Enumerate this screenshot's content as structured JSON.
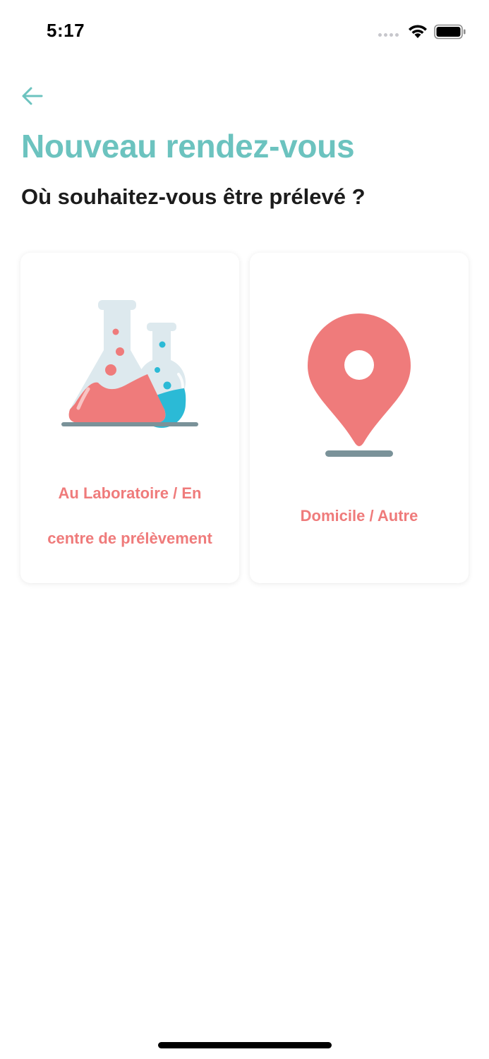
{
  "status_bar": {
    "time": "5:17",
    "icons": [
      "signal-icon",
      "wifi-icon",
      "battery-icon"
    ]
  },
  "header": {
    "back_icon": "arrow-left-icon",
    "title": "Nouveau rendez-vous",
    "subtitle": "Où souhaitez-vous être prélevé ?"
  },
  "options": [
    {
      "icon": "lab-flasks-icon",
      "label_line1": "Au Laboratoire / En",
      "label_line2": "centre de prélèvement"
    },
    {
      "icon": "location-pin-icon",
      "label_line1": "Domicile / Autre"
    }
  ],
  "colors": {
    "accent_teal": "#6cc3bf",
    "accent_coral": "#ef7b7b",
    "accent_blue": "#2bbad6",
    "text_dark": "#1c1c1c"
  }
}
